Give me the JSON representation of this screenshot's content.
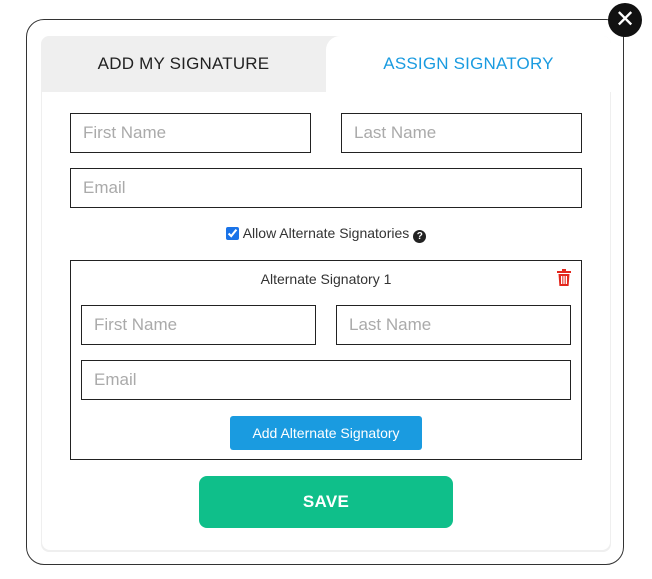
{
  "tabs": {
    "add_my_signature": "ADD MY SIGNATURE",
    "assign_signatory": "ASSIGN SIGNATORY"
  },
  "signatory": {
    "first_name_placeholder": "First Name",
    "last_name_placeholder": "Last Name",
    "email_placeholder": "Email"
  },
  "allow_alternate": {
    "label": "Allow Alternate Signatories",
    "checked": true
  },
  "alternate": {
    "title": "Alternate Signatory 1",
    "first_name_placeholder": "First Name",
    "last_name_placeholder": "Last Name",
    "email_placeholder": "Email",
    "add_button": "Add Alternate Signatory"
  },
  "save_button": "SAVE",
  "close_icon": "close-icon",
  "colors": {
    "active_tab": "#1a9be0",
    "add_button": "#1a9be0",
    "save_button": "#0fbf8a",
    "trash": "#e3261c"
  }
}
